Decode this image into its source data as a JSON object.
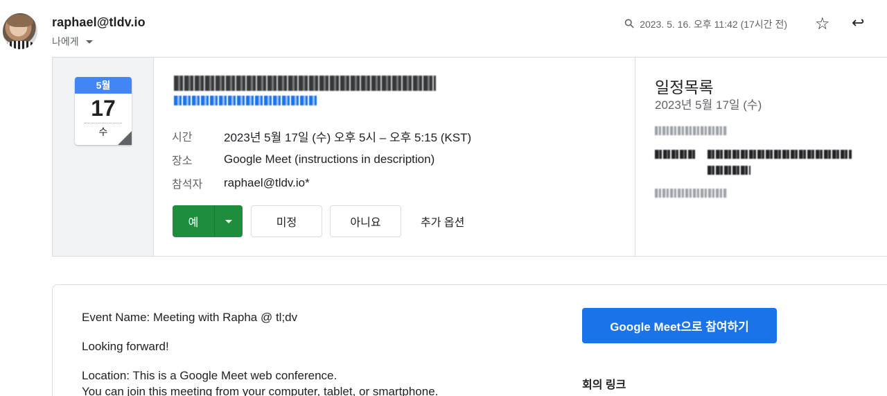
{
  "header": {
    "sender": "raphael@tldv.io",
    "recipient": "나에게",
    "timestamp": "2023. 5. 16. 오후 11:42 (17시간 전)",
    "icons": {
      "attachment": "paperclip-icon",
      "star": "star-icon",
      "reply": "reply-icon"
    }
  },
  "invite": {
    "calendar_icon": {
      "month": "5월",
      "day": "17",
      "weekday": "수"
    },
    "details": [
      {
        "label": "시간",
        "value": "2023년 5월 17일 (수) 오후 5시 – 오후 5:15 (KST)"
      },
      {
        "label": "장소",
        "value": "Google Meet (instructions in description)"
      },
      {
        "label": "참석자",
        "value": "raphael@tldv.io*"
      }
    ],
    "rsvp": {
      "yes": "예",
      "maybe": "미정",
      "no": "아니요",
      "more": "추가 옵션"
    },
    "agenda": {
      "title": "일정목록",
      "date": "2023년 5월 17일 (수)"
    }
  },
  "description": {
    "lines": [
      "Event Name: Meeting with Rapha @ tl;dv",
      "Looking forward!",
      "Location: This is a Google Meet web conference.",
      "You can join this meeting from your computer, tablet, or smartphone."
    ],
    "join_button": "Google Meet으로 참여하기",
    "link_label": "회의 링크"
  },
  "colors": {
    "accent_blue": "#1a73e8",
    "calendar_blue": "#4285f4",
    "yes_green": "#1e8e3e",
    "border": "#dadce0",
    "muted_text": "#5f6368"
  }
}
